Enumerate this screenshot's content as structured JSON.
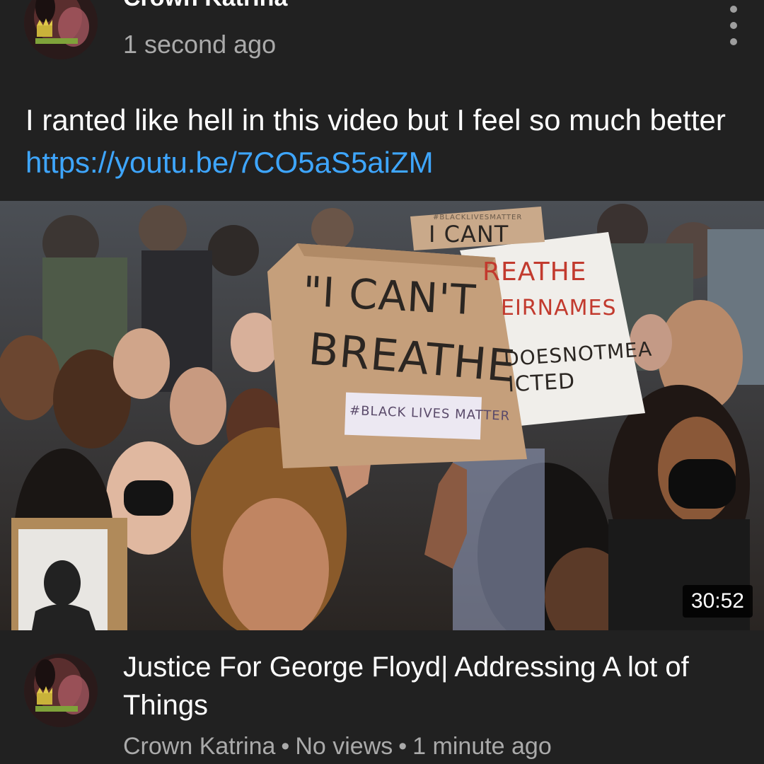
{
  "post": {
    "channel_name": "Crown Katrina",
    "timestamp": "1 second ago",
    "text": "I ranted like hell in this video but I feel so much better ",
    "link": "https://youtu.be/7CO5aS5aiZM",
    "menu_icon": "more-vert-icon"
  },
  "thumbnail": {
    "duration": "30:52",
    "signs": {
      "main_line1": "\"I CAN'T",
      "main_line2": "BREATHE",
      "main_tag": "#BLACK LIVES MATTER",
      "back_top": "I CANT",
      "back_line1": "REATHE",
      "back_line2": "EIRNAMES",
      "back_line3": "DOESNOTMEA",
      "back_line4": "ICTED",
      "back_small": "#BLACKLIVESMATTER"
    }
  },
  "video": {
    "title": "Justice For George Floyd| Addressing A lot of Things",
    "channel": "Crown Katrina",
    "views": "No views",
    "age": "1 minute ago",
    "separator": "•"
  },
  "colors": {
    "background": "#212121",
    "link": "#3ea6ff",
    "secondary_text": "#aaaaaa"
  }
}
